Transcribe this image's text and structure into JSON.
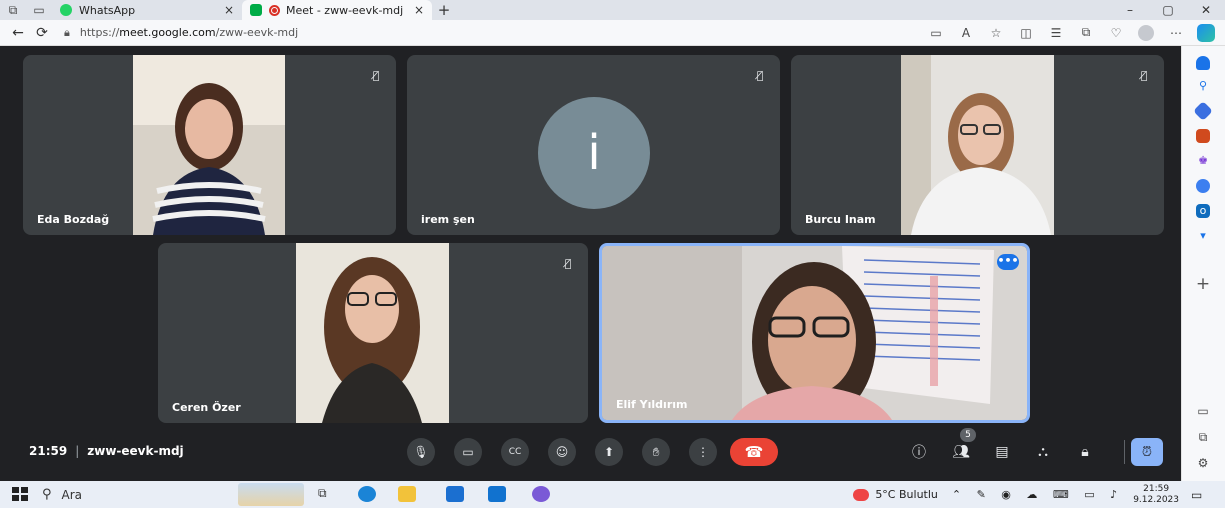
{
  "browser": {
    "tabs": [
      {
        "title": "WhatsApp",
        "active": false
      },
      {
        "title": "Meet - zww-eevk-mdj",
        "active": true
      }
    ],
    "url_scheme": "https://",
    "url_host": "meet.google.com",
    "url_path": "/zww-eevk-mdj",
    "new_tab": "+",
    "close_tab": "×",
    "win_min": "–",
    "win_max": "▢",
    "win_close": "✕",
    "back": "←",
    "refresh": "⟳",
    "more": "⋯"
  },
  "participants": [
    {
      "name": "Eda Bozdağ",
      "muted": true
    },
    {
      "name": "irem şen",
      "muted": true,
      "avatar_letter": "i"
    },
    {
      "name": "Burcu Inam",
      "muted": true
    },
    {
      "name": "Ceren Özer",
      "muted": true
    },
    {
      "name": "Elif Yıldırım",
      "muted": false,
      "active_speaker": true
    }
  ],
  "meeting": {
    "time": "21:59",
    "separator": "|",
    "code": "zww-eevk-mdj",
    "participant_count": "5"
  },
  "taskbar": {
    "search_placeholder": "Ara",
    "weather": "5°C Bulutlu",
    "time": "21:59",
    "date": "9.12.2023"
  },
  "colors": {
    "hangup": "#ea4335",
    "active_border": "#8ab4f8",
    "tile_bg": "#3c4043",
    "avatar_bg": "#788c96"
  }
}
